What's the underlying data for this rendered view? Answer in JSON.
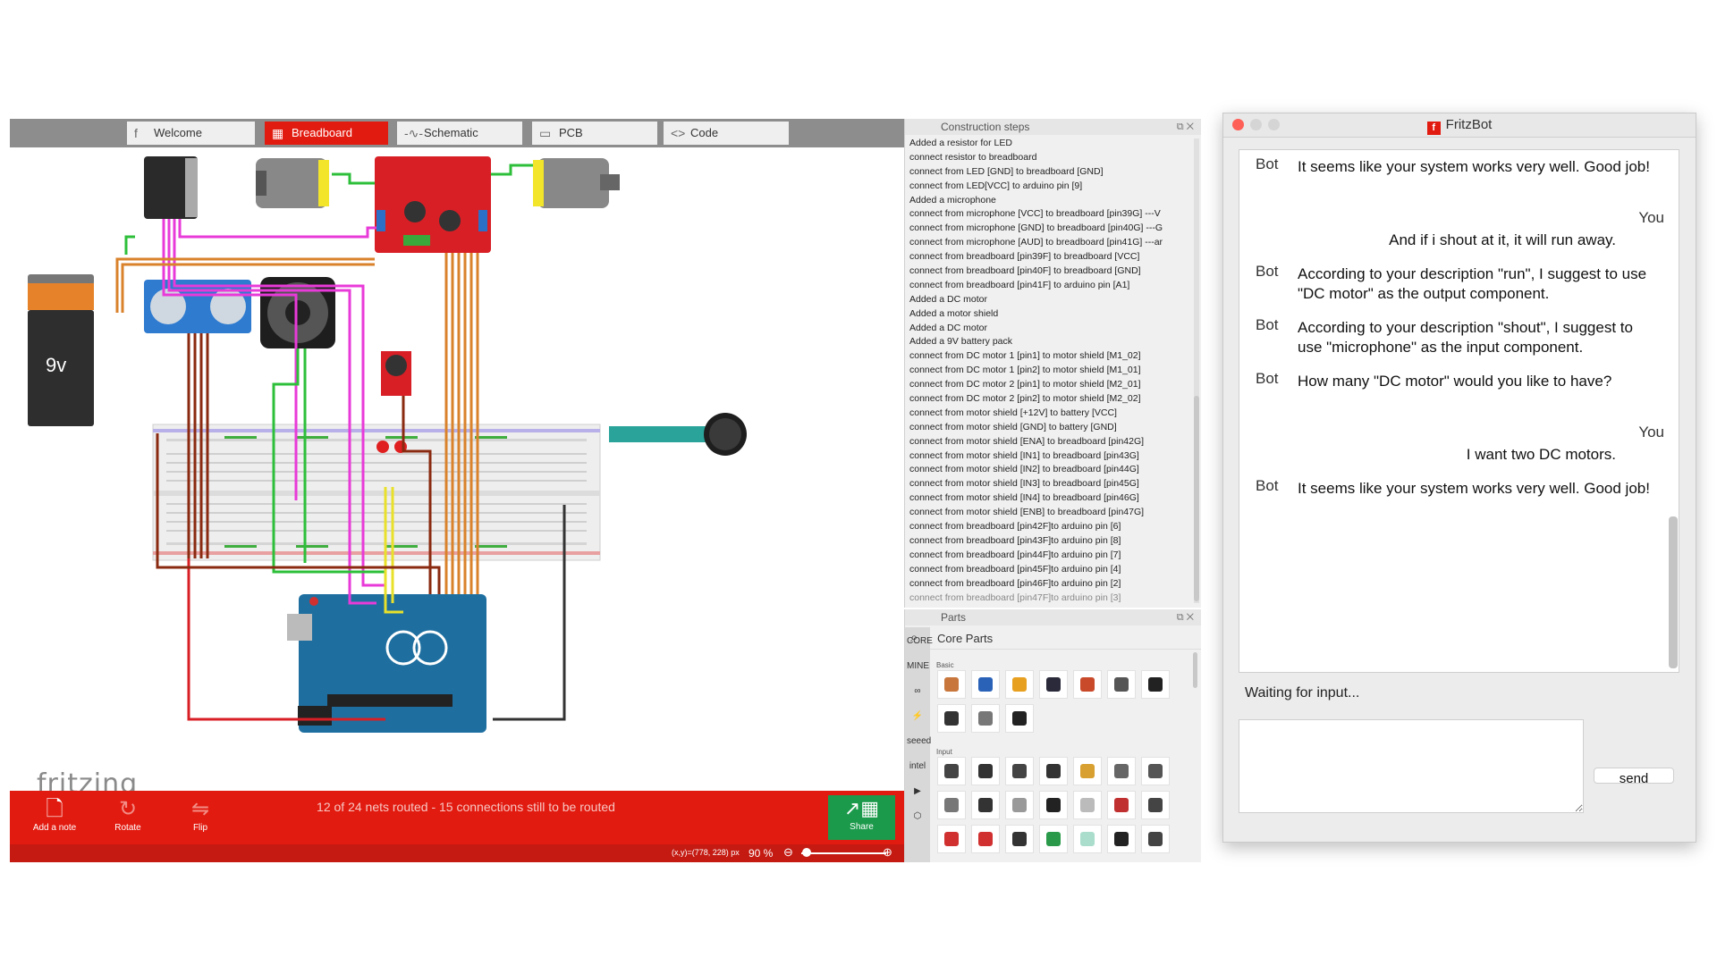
{
  "fritzing": {
    "tabs": [
      {
        "label": "Welcome",
        "icon": "f"
      },
      {
        "label": "Breadboard",
        "icon": "▦"
      },
      {
        "label": "Schematic",
        "icon": "-∿-"
      },
      {
        "label": "PCB",
        "icon": "▭"
      },
      {
        "label": "Code",
        "icon": "<>"
      }
    ],
    "active_tab": "Breadboard",
    "logo_text": "fritzing",
    "battery_label": "9v",
    "toolbar": {
      "add_note": "Add a note",
      "rotate": "Rotate",
      "flip": "Flip",
      "share": "Share"
    },
    "route_status": "12 of 24 nets routed - 15 connections still to be routed",
    "coords": "(x,y)=(778, 228) px",
    "zoom": "90 %"
  },
  "construction_steps": {
    "title": "Construction steps",
    "items": [
      "Added a resistor for LED",
      "connect resistor to breadboard",
      "connect from LED [GND] to breadboard [GND]",
      "connect from LED[VCC] to arduino pin [9]",
      "Added a microphone",
      "connect from microphone [VCC] to breadboard [pin39G] ---V",
      "connect from microphone [GND] to breadboard [pin40G] ---G",
      "connect from microphone [AUD] to breadboard [pin41G] ---ar",
      "connect from breadboard [pin39F] to breadboard [VCC]",
      "connect from breadboard [pin40F] to breadboard [GND]",
      "connect from breadboard [pin41F] to arduino pin [A1]",
      "Added a DC motor",
      "Added a motor shield",
      "Added a DC motor",
      "Added a 9V battery pack",
      "connect from DC motor 1 [pin1] to motor shield [M1_02]",
      "connect from DC motor 1 [pin2] to motor shield [M1_01]",
      "connect from DC motor 2 [pin1] to motor shield [M2_01]",
      "connect from DC motor 2 [pin2] to motor shield [M2_02]",
      "connect from motor shield [+12V] to battery [VCC]",
      "connect from motor shield [GND] to battery [GND]",
      "connect from motor shield [ENA] to breadboard [pin42G]",
      "connect from motor shield [IN1] to breadboard [pin43G]",
      "connect from motor shield [IN2] to breadboard [pin44G]",
      "connect from motor shield [IN3] to breadboard [pin45G]",
      "connect from motor shield [IN4] to breadboard [pin46G]",
      "connect from motor shield [ENB] to breadboard [pin47G]",
      "connect from breadboard [pin42F]to arduino pin [6]",
      "connect from breadboard [pin43F]to arduino pin [8]",
      "connect from breadboard [pin44F]to arduino pin [7]",
      "connect from breadboard [pin45F]to arduino pin [4]",
      "connect from breadboard [pin46F]to arduino pin [2]",
      "connect from breadboard [pin47F]to arduino pin [3]"
    ]
  },
  "parts": {
    "title": "Parts",
    "bin_name": "Core Parts",
    "side": [
      "CORE",
      "MINE",
      "∞",
      "⚡",
      "seeed",
      "intel",
      "▶",
      "⬡"
    ],
    "sections": [
      "Basic",
      "Input"
    ],
    "basic_colors": [
      "#c8763b",
      "#2a62b8",
      "#e8a020",
      "#2a2a3a",
      "#c84a2a",
      "#555555",
      "#222222",
      "#333333",
      "#777777",
      "#222222"
    ],
    "input_colors": [
      "#444444",
      "#333333",
      "#444444",
      "#333333",
      "#d8a030",
      "#666666",
      "#555555",
      "#777777",
      "#333333",
      "#999999",
      "#222222",
      "#bbbbbb",
      "#c03030",
      "#444444",
      "#d03030",
      "#d03030",
      "#333333",
      "#2a9a4a",
      "#aaddcc",
      "#222222",
      "#444444"
    ]
  },
  "fritzbot": {
    "title": "FritzBot",
    "messages": [
      {
        "who": "Bot",
        "text": "It seems like your system works very well. Good job!"
      },
      {
        "who": "You",
        "text": "And if i shout at it, it will run away."
      },
      {
        "who": "Bot",
        "text": "According to your description \"run\", I suggest to use \"DC motor\" as the output component."
      },
      {
        "who": "Bot",
        "text": "According to your description \"shout\", I suggest to use \"microphone\" as the input component."
      },
      {
        "who": "Bot",
        "text": "How many \"DC motor\" would you like to have?"
      },
      {
        "who": "You",
        "text": "I want two DC motors."
      },
      {
        "who": "Bot",
        "text": "It seems like your system works very well. Good job!"
      }
    ],
    "status": "Waiting for input...",
    "input_value": "",
    "send_label": "send"
  },
  "colors": {
    "fritzing_red": "#e21b10",
    "share_green": "#1c9a4b",
    "wire_magenta": "#e83ad8",
    "wire_orange": "#d9822b",
    "wire_green": "#2dbf3a",
    "wire_yellow": "#e8e02a",
    "wire_darkred": "#8a2a10"
  }
}
